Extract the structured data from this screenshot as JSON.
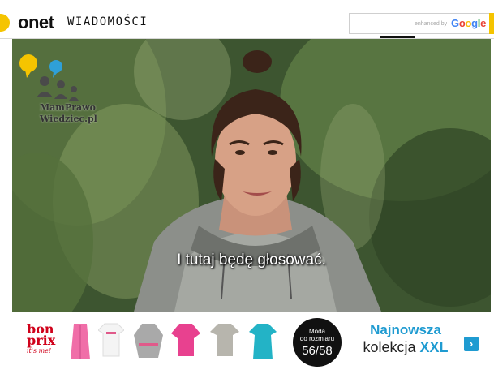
{
  "header": {
    "brand": "onet",
    "section": "WIADOMOŚCI",
    "search": {
      "placeholder": "",
      "enhanced_by": "enhanced by",
      "google_letters": [
        "G",
        "o",
        "o",
        "g",
        "l",
        "e"
      ]
    }
  },
  "video": {
    "subtitle": "I tutaj będę głosować.",
    "overlay_logo": {
      "line1": "MamPrawo",
      "line2": "Wiedziec.pl"
    }
  },
  "ad": {
    "brand": {
      "line1": "bon",
      "line2": "prix",
      "tagline": "it's me!"
    },
    "badge": {
      "line1": "Moda",
      "line2": "do rozmiaru",
      "size": "56/58"
    },
    "headline_line1": "Najnowsza",
    "headline_line2_prefix": "kolekcja ",
    "headline_line2_emph": "XXL",
    "arrow_icon": "chevron-right-icon",
    "garments": [
      {
        "name": "pink-coat",
        "color": "#f06ea8"
      },
      {
        "name": "white-tshirt",
        "color": "#f4f4f4"
      },
      {
        "name": "grey-sweater",
        "color": "#a9a9a9"
      },
      {
        "name": "pink-blouse",
        "color": "#e8418f"
      },
      {
        "name": "grey-tee",
        "color": "#b7b5ad"
      },
      {
        "name": "teal-tunic",
        "color": "#23b3c6"
      }
    ]
  },
  "colors": {
    "onet_yellow": "#f5c400",
    "ad_blue": "#1f9bd1",
    "bonprix_red": "#d0021b"
  }
}
